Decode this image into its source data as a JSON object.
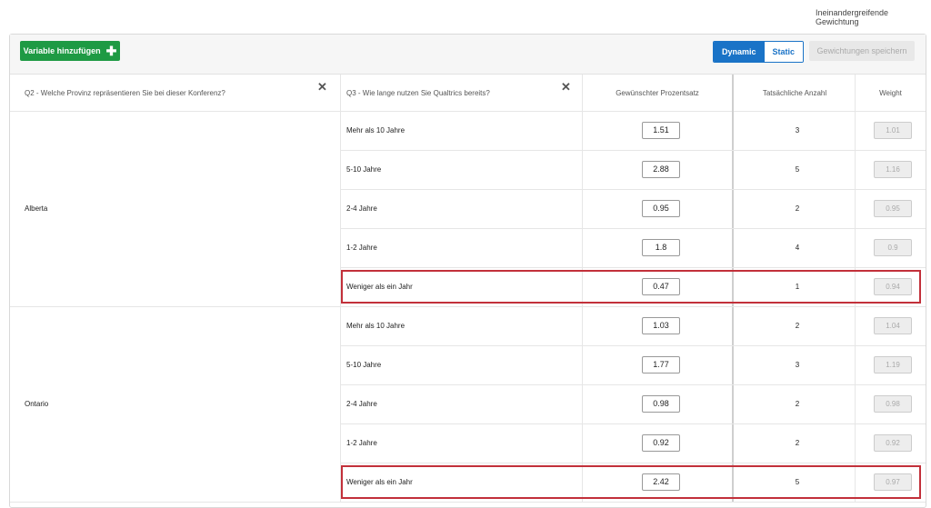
{
  "top_label": "Ineinandergreifende Gewichtung",
  "toolbar": {
    "add_variable_label": "Variable hinzufügen",
    "mode_dynamic": "Dynamic",
    "mode_static": "Static",
    "save_weights_label": "Gewichtungen speichern"
  },
  "headers": {
    "q2": "Q2 - Welche Provinz repräsentieren Sie bei dieser Konferenz?",
    "q3": "Q3 - Wie lange nutzen Sie Qualtrics bereits?",
    "pct": "Gewünschter Prozentsatz",
    "count": "Tatsächliche Anzahl",
    "weight": "Weight"
  },
  "icons": {
    "remove": "close-icon",
    "add": "plus-icon"
  },
  "colors": {
    "accent_blue": "#1a73c7",
    "add_green": "#1e9a44",
    "highlight_red": "#c2303a"
  },
  "groups": [
    {
      "province": "Alberta",
      "rows": [
        {
          "category": "Mehr als 10 Jahre",
          "pct": "1.51",
          "count": "3",
          "weight": "1.01",
          "highlighted": false
        },
        {
          "category": "5-10 Jahre",
          "pct": "2.88",
          "count": "5",
          "weight": "1.16",
          "highlighted": false
        },
        {
          "category": "2-4 Jahre",
          "pct": "0.95",
          "count": "2",
          "weight": "0.95",
          "highlighted": false
        },
        {
          "category": "1-2 Jahre",
          "pct": "1.8",
          "count": "4",
          "weight": "0.9",
          "highlighted": false
        },
        {
          "category": "Weniger als ein Jahr",
          "pct": "0.47",
          "count": "1",
          "weight": "0.94",
          "highlighted": true
        }
      ]
    },
    {
      "province": "Ontario",
      "rows": [
        {
          "category": "Mehr als 10 Jahre",
          "pct": "1.03",
          "count": "2",
          "weight": "1.04",
          "highlighted": false
        },
        {
          "category": "5-10 Jahre",
          "pct": "1.77",
          "count": "3",
          "weight": "1.19",
          "highlighted": false
        },
        {
          "category": "2-4 Jahre",
          "pct": "0.98",
          "count": "2",
          "weight": "0.98",
          "highlighted": false
        },
        {
          "category": "1-2 Jahre",
          "pct": "0.92",
          "count": "2",
          "weight": "0.92",
          "highlighted": false
        },
        {
          "category": "Weniger als ein Jahr",
          "pct": "2.42",
          "count": "5",
          "weight": "0.97",
          "highlighted": true
        }
      ]
    }
  ]
}
